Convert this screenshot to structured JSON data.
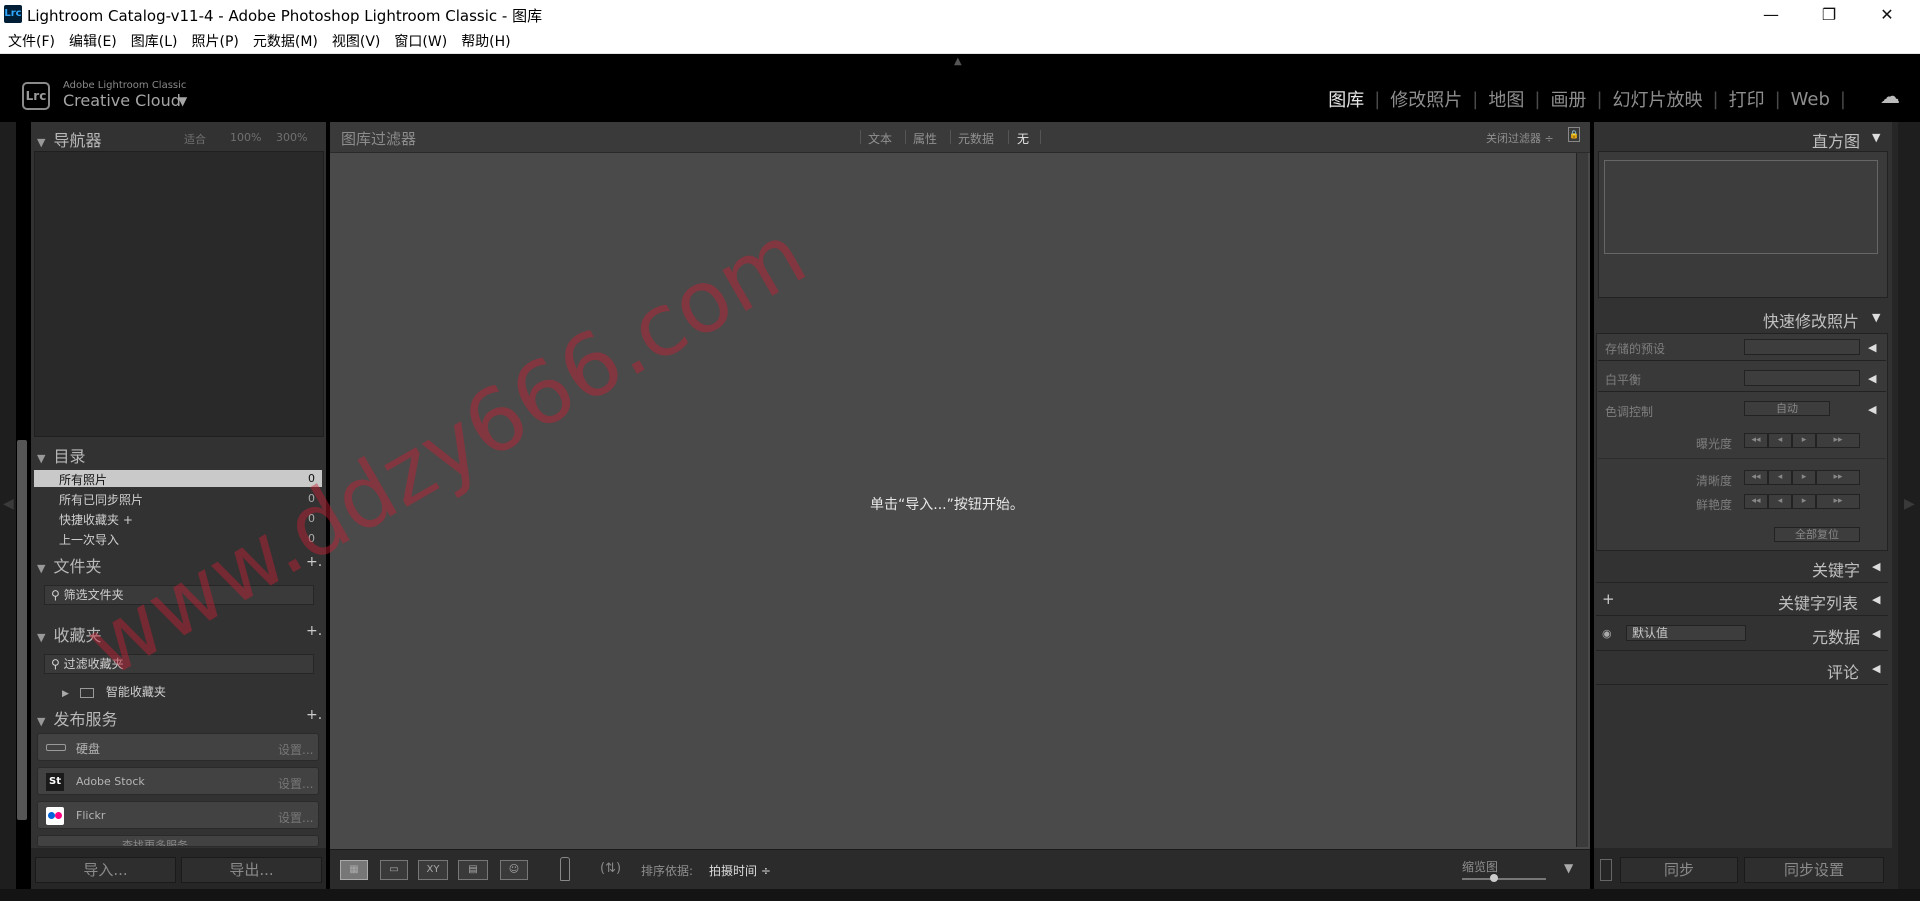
{
  "window": {
    "title": "Lightroom Catalog-v11-4 - Adobe Photoshop Lightroom Classic - 图库",
    "app_icon": "Lrc",
    "minimize_glyph": "—",
    "maximize_glyph": "❐",
    "close_glyph": "✕"
  },
  "menu": [
    "文件(F)",
    "编辑(E)",
    "图库(L)",
    "照片(P)",
    "元数据(M)",
    "视图(V)",
    "窗口(W)",
    "帮助(H)"
  ],
  "identity": {
    "badge": "Lrc",
    "small": "Adobe Lightroom Classic",
    "big": "Creative Cloud",
    "caret": "▼"
  },
  "modules": [
    "图库",
    "修改照片",
    "地图",
    "画册",
    "幻灯片放映",
    "打印",
    "Web"
  ],
  "left_panel": {
    "navigator": {
      "title": "导航器",
      "zoom_fit": "适合",
      "zoom_100": "100%",
      "zoom_300": "300%"
    },
    "catalog": {
      "title": "目录",
      "items": [
        {
          "label": "所有照片",
          "count": "0"
        },
        {
          "label": "所有已同步照片",
          "count": "0"
        },
        {
          "label": "快捷收藏夹 +",
          "count": "0"
        },
        {
          "label": "上一次导入",
          "count": "0"
        }
      ]
    },
    "folders": {
      "title": "文件夹",
      "add": "+.",
      "filter": "筛选文件夹"
    },
    "collections": {
      "title": "收藏夹",
      "add": "+.",
      "filter": "过滤收藏夹",
      "smart": "智能收藏夹"
    },
    "publish": {
      "title": "发布服务",
      "add": "+.",
      "items": [
        {
          "label": "硬盘",
          "setup": "设置..."
        },
        {
          "label": "Adobe Stock",
          "setup": "设置...",
          "badge": "St"
        },
        {
          "label": "Flickr",
          "setup": "设置..."
        }
      ],
      "more": "查找更多服务..."
    },
    "import_label": "导入...",
    "export_label": "导出..."
  },
  "filter_bar": {
    "title": "图库过滤器",
    "tabs": [
      "文本",
      "属性",
      "元数据",
      "无"
    ],
    "close": "关闭过滤器 ÷"
  },
  "center": {
    "empty_message": "单击“导入...”按钮开始。"
  },
  "toolbar": {
    "sort_label": "排序依据:",
    "sort_value": "拍摄时间 ÷",
    "thumbnails_label": "缩览图",
    "compare_icon": "XY"
  },
  "right_panel": {
    "histogram": {
      "title": "直方图"
    },
    "quick_develop": {
      "title": "快速修改照片",
      "saved_preset": "存储的预设",
      "white_balance": "白平衡",
      "tone_control": "色调控制",
      "auto": "自动",
      "exposure": "曝光度",
      "clarity": "清晰度",
      "vibrance": "鲜艳度",
      "reset_all": "全部复位",
      "step_ll": "◂◂",
      "step_l": "◂",
      "step_r": "▸",
      "step_rr": "▸▸"
    },
    "keywording": {
      "title": "关键字"
    },
    "keyword_list": {
      "title": "关键字列表",
      "add": "+"
    },
    "metadata": {
      "title": "元数据",
      "preset": "默认值"
    },
    "comments": {
      "title": "评论"
    },
    "sync_label": "同步",
    "sync_settings_label": "同步设置"
  },
  "watermark": "www.ddzy666.com"
}
